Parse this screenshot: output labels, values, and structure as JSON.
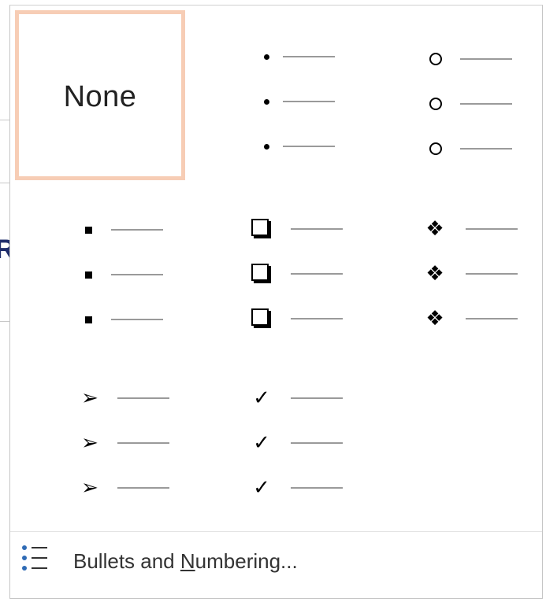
{
  "gallery": {
    "none_label": "None",
    "items": [
      {
        "name": "none",
        "icon": "none"
      },
      {
        "name": "small-dot",
        "icon": "small-dot-icon"
      },
      {
        "name": "hollow-circle",
        "icon": "hollow-circle-icon"
      },
      {
        "name": "small-square",
        "icon": "small-square-icon"
      },
      {
        "name": "shadow-box",
        "icon": "shadow-box-icon"
      },
      {
        "name": "four-diamond",
        "icon": "four-diamond-icon"
      },
      {
        "name": "arrowhead",
        "icon": "arrowhead-icon"
      },
      {
        "name": "checkmark",
        "icon": "checkmark-icon"
      }
    ],
    "glyphs": {
      "four_diamond": "❖",
      "arrowhead": "➢",
      "checkmark": "✓"
    }
  },
  "footer": {
    "label_prefix": "Bullets and ",
    "label_mnemonic": "N",
    "label_suffix": "umbering...",
    "icon": "bulleted-list-icon"
  },
  "colors": {
    "selection_border": "#f7cdb5",
    "list_icon_blue": "#2f6bb5",
    "document_heading": "#1f2d6b"
  },
  "background_document": {
    "glyph": "R"
  }
}
